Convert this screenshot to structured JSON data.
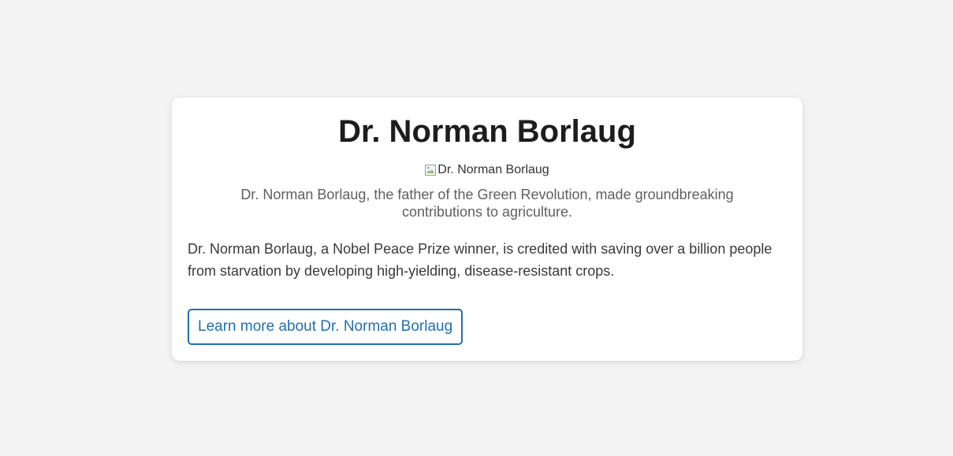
{
  "card": {
    "title": "Dr. Norman Borlaug",
    "image_alt": "Dr. Norman Borlaug",
    "caption": "Dr. Norman Borlaug, the father of the Green Revolution, made groundbreaking contributions to agriculture.",
    "description": "Dr. Norman Borlaug, a Nobel Peace Prize winner, is credited with saving over a billion people from starvation by developing high-yielding, disease-resistant crops.",
    "button_label": "Learn more about Dr. Norman Borlaug",
    "broken_image_icon": "broken-image-icon"
  },
  "colors": {
    "background": "#f3f3f3",
    "card": "#ffffff",
    "accent": "#1f6fb2",
    "title": "#1d1d1d",
    "caption": "#5f5f5f",
    "body": "#3a3a3a"
  }
}
